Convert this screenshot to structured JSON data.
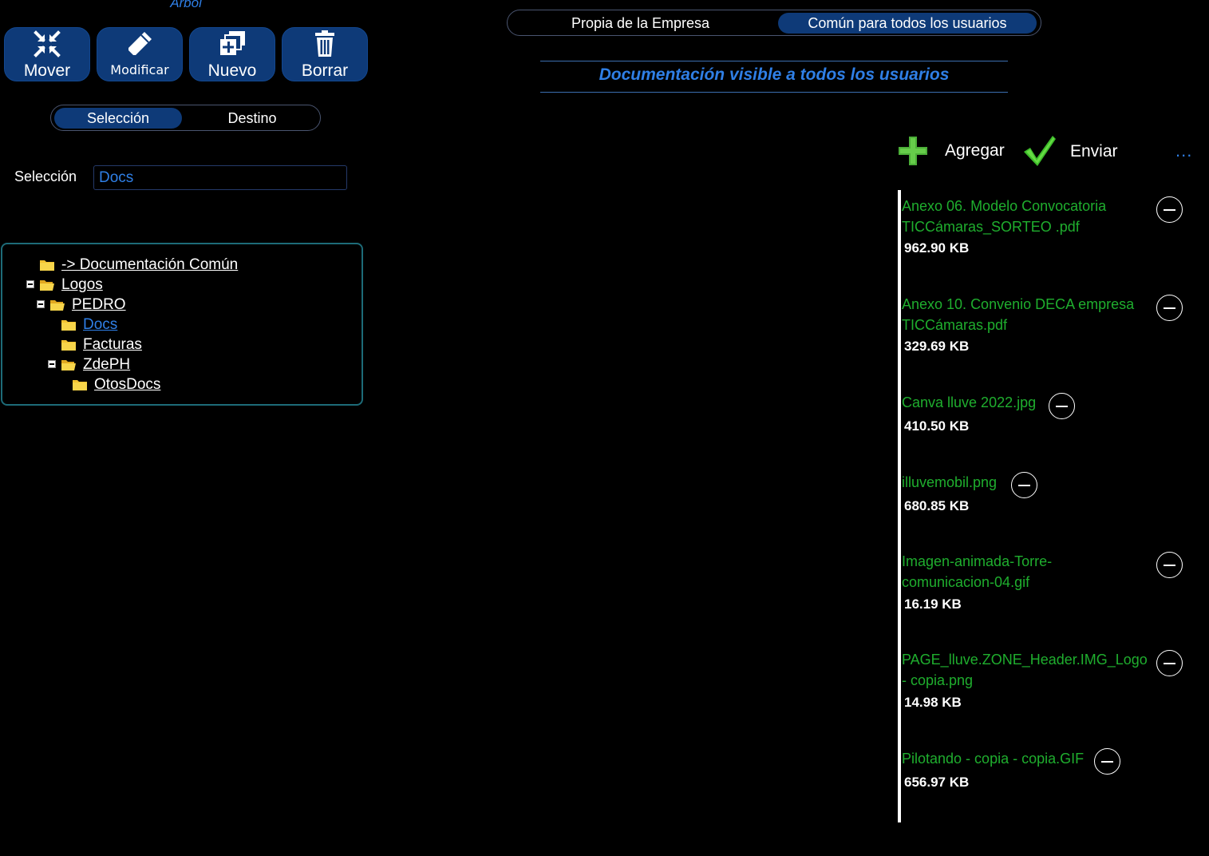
{
  "toolbar": {
    "title": "Árbol",
    "mover": "Mover",
    "modificar": "Modificar",
    "nuevo": "Nuevo",
    "borrar": "Borrar"
  },
  "mode_toggle": {
    "seleccion": "Selección",
    "destino": "Destino",
    "active": "Selección"
  },
  "selection": {
    "label": "Selección",
    "value": "Docs"
  },
  "tree": {
    "items": [
      {
        "label": "-> Documentación Común",
        "level": 0
      },
      {
        "label": "Logos",
        "level": 0
      },
      {
        "label": "PEDRO",
        "level": 1
      },
      {
        "label": "Docs",
        "level": 2
      },
      {
        "label": "Facturas",
        "level": 2
      },
      {
        "label": "ZdePH",
        "level": 2
      },
      {
        "label": "OtosDocs",
        "level": 3
      }
    ]
  },
  "scope_toggle": {
    "propia": "Propia de la Empresa",
    "comun": "Común para todos los usuarios",
    "active": "Común para todos los usuarios"
  },
  "doc_heading": "Documentación visible a todos los usuarios",
  "actions": {
    "agregar": "Agregar",
    "enviar": "Enviar",
    "more": "..."
  },
  "files": [
    {
      "name_line1": "Anexo 06. Modelo Convocatoria",
      "name_line2": "TICCámaras_SORTEO .pdf",
      "size": "962.90 KB"
    },
    {
      "name_line1": "Anexo 10. Convenio DECA empresa",
      "name_line2": "TICCámaras.pdf",
      "size": "329.69 KB"
    },
    {
      "name_line1": "Canva lluve 2022.jpg",
      "name_line2": "",
      "size": "410.50 KB"
    },
    {
      "name_line1": "illuvemobil.png",
      "name_line2": "",
      "size": "680.85 KB"
    },
    {
      "name_line1": "Imagen-animada-Torre-",
      "name_line2": "comunicacion-04.gif",
      "size": "16.19 KB"
    },
    {
      "name_line1": "PAGE_lluve.ZONE_Header.IMG_Logo",
      "name_line2": "- copia.png",
      "size": "14.98 KB"
    },
    {
      "name_line1": "Pilotando - copia - copia.GIF",
      "name_line2": "",
      "size": "656.97 KB"
    }
  ],
  "colors": {
    "accent": "#2f7fe6",
    "button": "#0e3a78",
    "file_green": "#1fae2e"
  }
}
